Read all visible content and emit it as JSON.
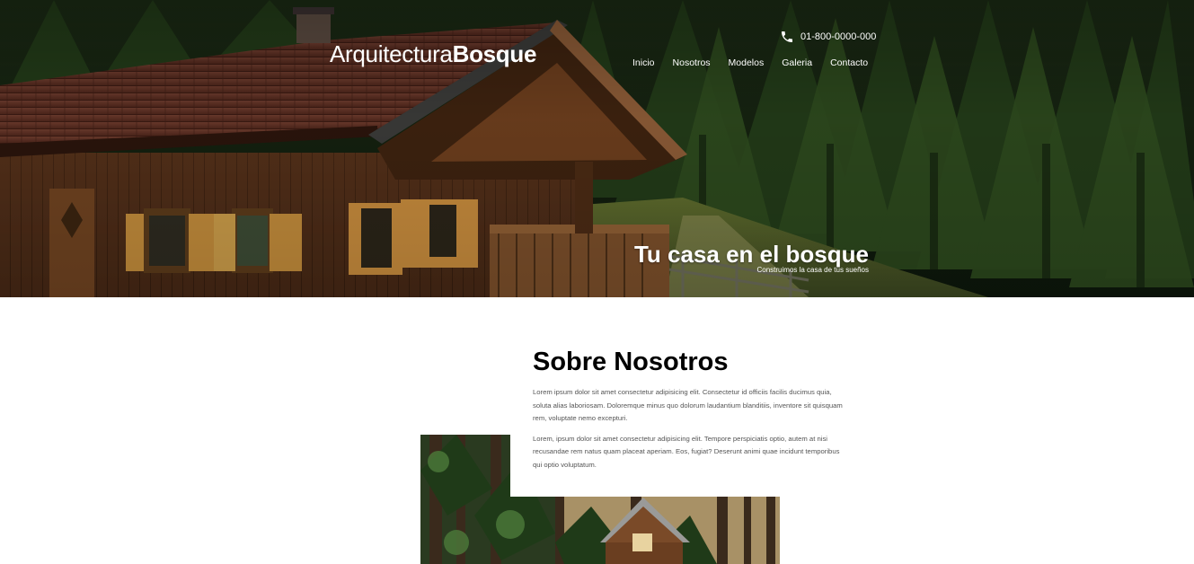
{
  "brand": {
    "name_regular": "Arquitectura",
    "name_bold": "Bosque"
  },
  "contact": {
    "phone": "01-800-0000-000",
    "phone_icon": "phone-icon"
  },
  "nav": {
    "items": [
      {
        "label": "Inicio"
      },
      {
        "label": "Nosotros"
      },
      {
        "label": "Modelos"
      },
      {
        "label": "Galeria"
      },
      {
        "label": "Contacto"
      }
    ]
  },
  "hero": {
    "title": "Tu casa en el bosque",
    "subtitle": "Construimos la casa de tus sueños"
  },
  "about": {
    "title": "Sobre Nosotros",
    "paragraphs": [
      "Lorem ipsum dolor sit amet consectetur adipisicing elit. Consectetur id officiis facilis ducimus quia, soluta alias laboriosam. Doloremque minus quo dolorum laudantium blanditiis, inventore sit quisquam rem, voluptate nemo excepturi.",
      "Lorem, ipsum dolor sit amet consectetur adipisicing elit. Tempore perspiciatis optio, autem at nisi recusandae rem natus quam placeat aperiam. Eos, fugiat? Deserunt animi quae incidunt temporibus qui optio voluptatum."
    ]
  },
  "colors": {
    "text_white": "#ffffff",
    "heading": "#000000",
    "body_text": "#555555",
    "background": "#ffffff"
  }
}
